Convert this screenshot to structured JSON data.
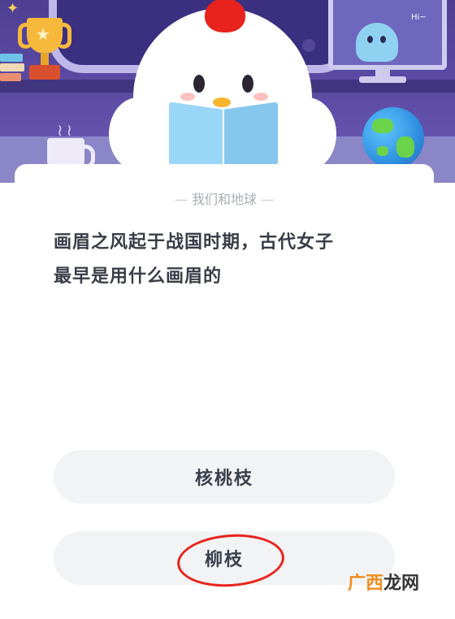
{
  "header": {
    "monitor_text": "Hi~"
  },
  "card": {
    "category": "我们和地球",
    "question_line1": "画眉之风起于战国时期，古代女子",
    "question_line2": "最早是用什么画眉的",
    "options": [
      {
        "label": "核桃枝"
      },
      {
        "label": "柳枝",
        "marked": true
      }
    ]
  },
  "watermark": {
    "part1": "广西",
    "part2": "龙网"
  },
  "colors": {
    "header_bg": "#5b4aa4",
    "card_bg": "#ffffff",
    "option_bg": "#f1f3f5",
    "text_dark": "#393d47",
    "text_muted": "#a9adb6",
    "annotation_red": "#e8231d",
    "watermark_orange": "#f08c1c"
  }
}
